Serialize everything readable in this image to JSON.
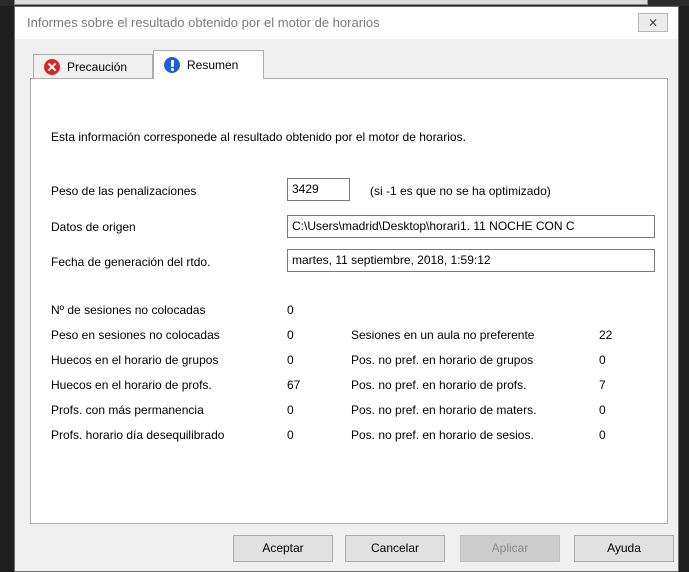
{
  "window": {
    "title": "Informes sobre el resultado obtenido por el motor de horarios",
    "close_label": "⨯"
  },
  "tabs": [
    {
      "label": "Precaución",
      "icon": "error-icon"
    },
    {
      "label": "Resumen",
      "icon": "info-icon"
    }
  ],
  "summary": {
    "intro": "Esta información corresponede al resultado obtenido por el motor de horarios.",
    "peso_label": "Peso de las penalizaciones",
    "peso_value": "3429",
    "peso_note": "(si  -1  es que no se ha optimizado)",
    "datos_label": "Datos de origen",
    "datos_value": "C:\\Users\\madrid\\Desktop\\horari1. 11 NOCHE CON C",
    "fecha_label": "Fecha de generación del rtdo.",
    "fecha_value": "martes, 11 septiembre, 2018, 1:59:12"
  },
  "stats_left": [
    {
      "label": "Nº de sesiones no colocadas",
      "value": "0"
    },
    {
      "label": "Peso en sesiones no colocadas",
      "value": "0"
    },
    {
      "label": "Huecos en el horario de grupos",
      "value": "0"
    },
    {
      "label": "Huecos en el horario de profs.",
      "value": "67"
    },
    {
      "label": "Profs. con más permanencia",
      "value": "0"
    },
    {
      "label": "Profs. horario día desequilibrado",
      "value": "0"
    }
  ],
  "stats_right": [
    {
      "label": "Sesiones en un aula no preferente",
      "value": "22"
    },
    {
      "label": "Pos. no pref. en horario de grupos",
      "value": "0"
    },
    {
      "label": "Pos. no pref. en horario de profs.",
      "value": "7"
    },
    {
      "label": "Pos. no pref. en horario de maters.",
      "value": "0"
    },
    {
      "label": "Pos. no pref. en horario de sesios.",
      "value": "0"
    }
  ],
  "buttons": {
    "accept": "Aceptar",
    "cancel": "Cancelar",
    "apply": "Aplicar",
    "help": "Ayuda"
  }
}
